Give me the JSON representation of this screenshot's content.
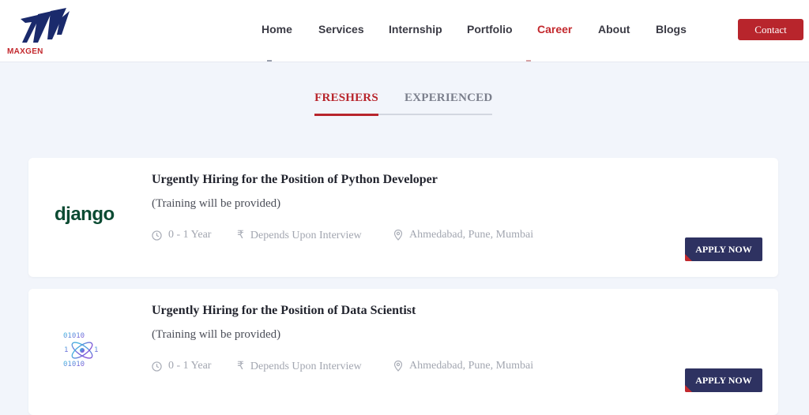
{
  "brand": {
    "name": "MAXGEN",
    "primary_color": "#c3282d",
    "dark_color": "#1a2a6c"
  },
  "nav": {
    "items": [
      {
        "label": "Home",
        "active": false
      },
      {
        "label": "Services",
        "active": false
      },
      {
        "label": "Internship",
        "active": false
      },
      {
        "label": "Portfolio",
        "active": false
      },
      {
        "label": "Career",
        "active": true
      },
      {
        "label": "About",
        "active": false
      },
      {
        "label": "Blogs",
        "active": false
      }
    ],
    "contact_label": "Contact"
  },
  "tabs": [
    {
      "label": "FRESHERS",
      "active": true
    },
    {
      "label": "EXPERIENCED",
      "active": false
    }
  ],
  "jobs": [
    {
      "logo": "django",
      "logo_text": "django",
      "title": "Urgently Hiring for the Position of Python Developer",
      "subtitle": "(Training will be provided)",
      "experience": "0 - 1 Year",
      "salary": "Depends Upon Interview",
      "location": "Ahmedabad, Pune, Mumbai",
      "apply_label": "APPLY NOW"
    },
    {
      "logo": "data-science-atom",
      "logo_text": "",
      "title": "Urgently Hiring for the Position of Data Scientist",
      "subtitle": "(Training will be provided)",
      "experience": "0 - 1 Year",
      "salary": "Depends Upon Interview",
      "location": "Ahmedabad, Pune, Mumbai",
      "apply_label": "APPLY NOW"
    }
  ],
  "icons": {
    "experience": "clock-icon",
    "salary": "rupee-icon",
    "location": "location-pin-icon"
  },
  "colors": {
    "apply_button": "#2e3261",
    "background": "#f2f5fb"
  }
}
